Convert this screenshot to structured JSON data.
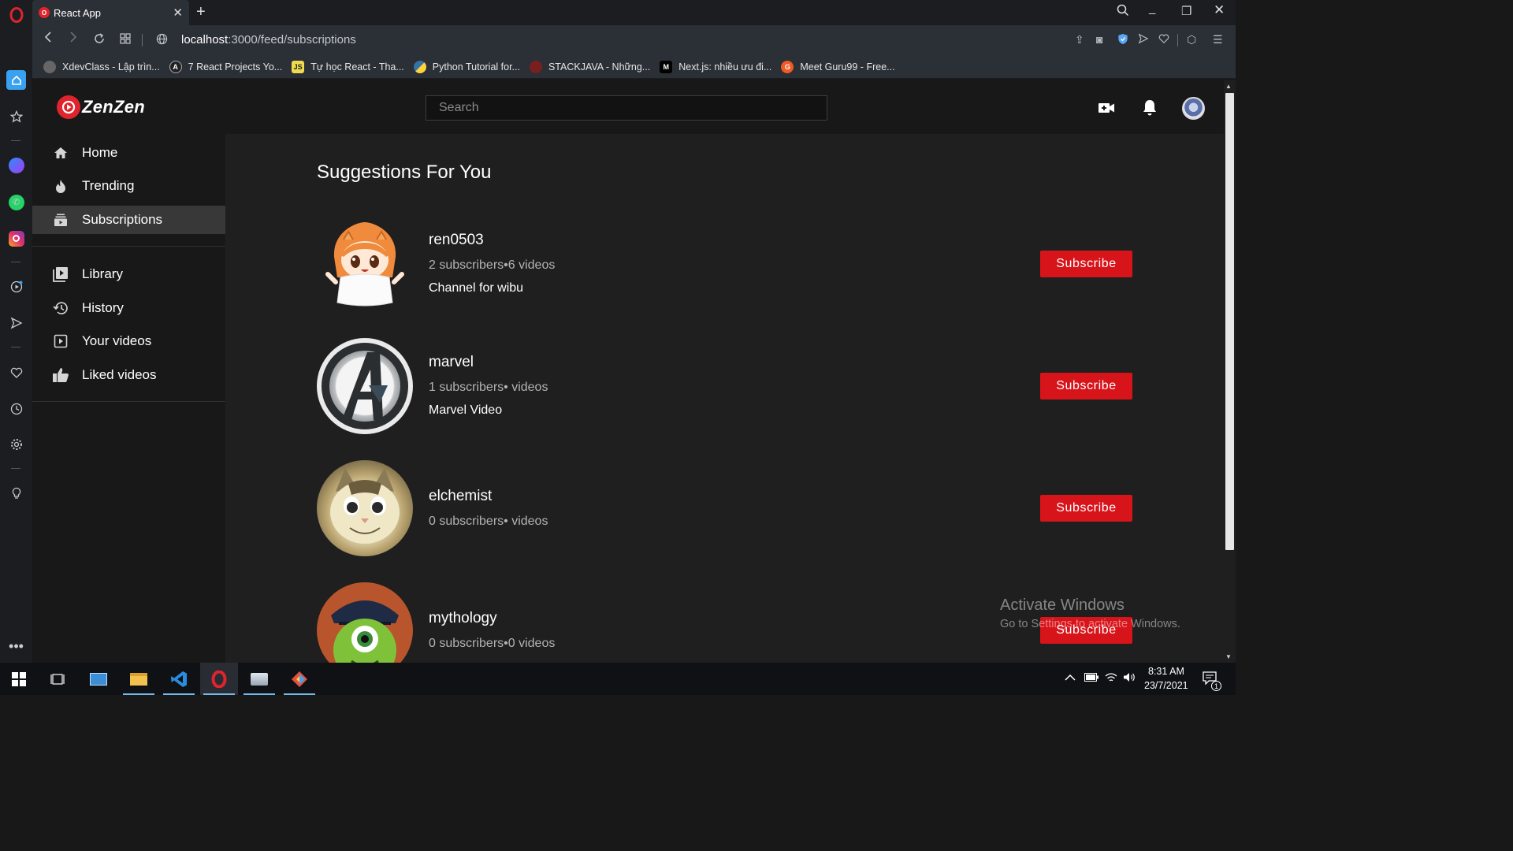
{
  "browser": {
    "tab_title": "React App",
    "url_host": "localhost",
    "url_path": ":3000/feed/subscriptions",
    "bookmarks": [
      {
        "label": "XdevClass - Lập trìn...",
        "icon": "xdevclass-icon",
        "color": "#666666"
      },
      {
        "label": "7 React Projects Yo...",
        "icon": "react-projects-icon",
        "color": "#222222"
      },
      {
        "label": "Tự học React - Tha...",
        "icon": "js-icon",
        "color": "#f0db4f"
      },
      {
        "label": "Python Tutorial for...",
        "icon": "python-icon",
        "color": "#3572a5"
      },
      {
        "label": "STACKJAVA - Những...",
        "icon": "stackjava-icon",
        "color": "#c0392b"
      },
      {
        "label": "Next.js: nhiều ưu đi...",
        "icon": "medium-icon",
        "color": "#000000"
      },
      {
        "label": "Meet Guru99 - Free...",
        "icon": "guru99-icon",
        "color": "#f15a24"
      }
    ]
  },
  "app": {
    "brand": "ZenZen",
    "search_placeholder": "Search",
    "accent": "#d7141a",
    "nav": [
      {
        "label": "Home",
        "icon": "home-icon"
      },
      {
        "label": "Trending",
        "icon": "fire-icon"
      },
      {
        "label": "Subscriptions",
        "icon": "subscriptions-icon",
        "active": true
      },
      {
        "label": "Library",
        "icon": "library-icon"
      },
      {
        "label": "History",
        "icon": "history-icon"
      },
      {
        "label": "Your videos",
        "icon": "your-videos-icon"
      },
      {
        "label": "Liked videos",
        "icon": "thumbs-up-icon"
      }
    ],
    "page_title": "Suggestions For You",
    "channels": [
      {
        "name": "ren0503",
        "stats": "2 subscribers•6 videos",
        "description": "Channel for wibu",
        "button": "Subscribe"
      },
      {
        "name": "marvel",
        "stats": "1 subscribers• videos",
        "description": "Marvel Video",
        "button": "Subscribe"
      },
      {
        "name": "elchemist",
        "stats": "0 subscribers• videos",
        "description": "",
        "button": "Subscribe"
      },
      {
        "name": "mythology",
        "stats": "0 subscribers•0 videos",
        "description": "",
        "button": "Subscribe"
      }
    ]
  },
  "watermark": {
    "line1": "Activate Windows",
    "line2": "Go to Settings to activate Windows."
  },
  "taskbar": {
    "time": "8:31 AM",
    "date": "23/7/2021",
    "notification_count": "1"
  }
}
